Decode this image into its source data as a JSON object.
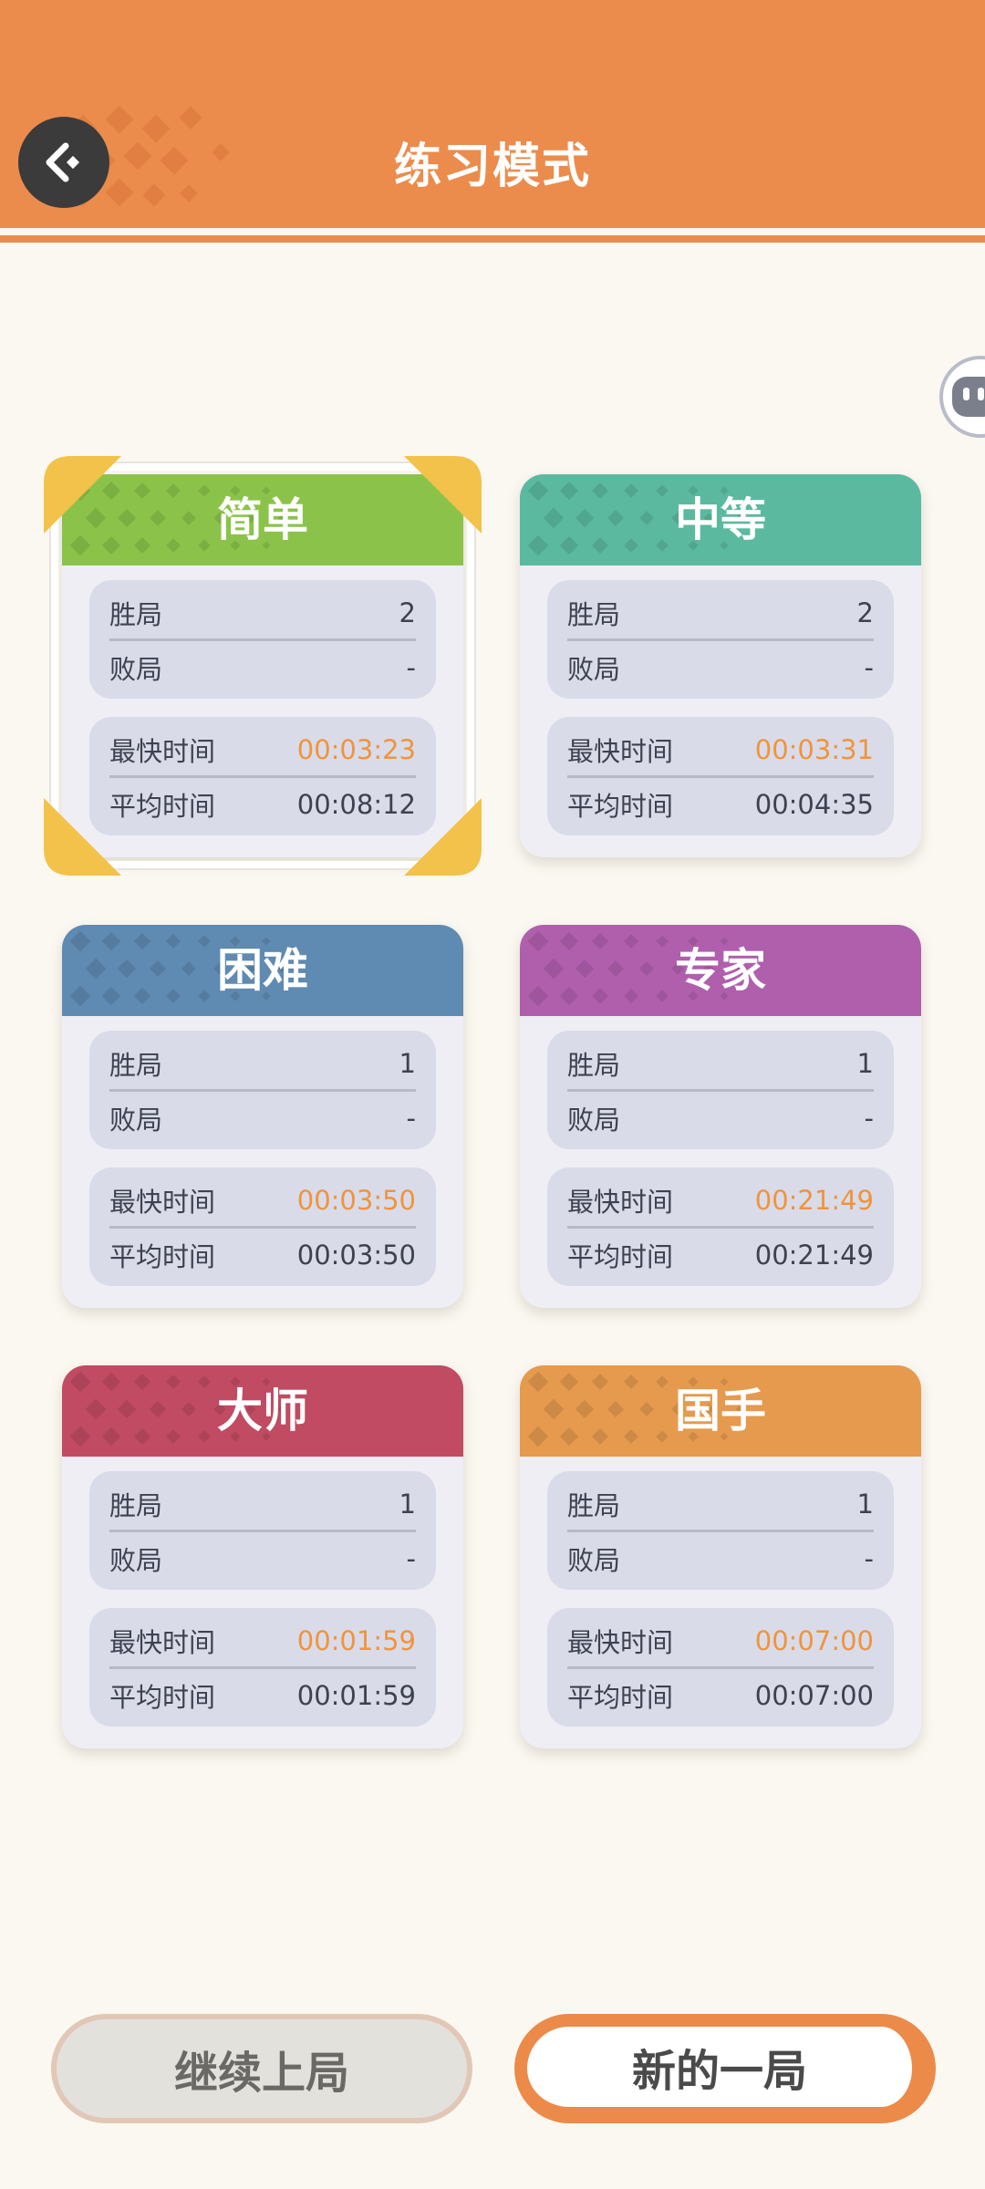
{
  "header": {
    "title": "练习模式",
    "color": "#eb8c4d"
  },
  "cards": [
    {
      "id": "easy",
      "title": "简单",
      "color": "#8bc34a",
      "selected": true,
      "wins_label": "胜局",
      "wins": "2",
      "losses_label": "败局",
      "losses": "-",
      "fastest_label": "最快时间",
      "fastest": "00:03:23",
      "average_label": "平均时间",
      "average": "00:08:12"
    },
    {
      "id": "medium",
      "title": "中等",
      "color": "#5bb9a0",
      "selected": false,
      "wins_label": "胜局",
      "wins": "2",
      "losses_label": "败局",
      "losses": "-",
      "fastest_label": "最快时间",
      "fastest": "00:03:31",
      "average_label": "平均时间",
      "average": "00:04:35"
    },
    {
      "id": "hard",
      "title": "困难",
      "color": "#5f8ab2",
      "selected": false,
      "wins_label": "胜局",
      "wins": "1",
      "losses_label": "败局",
      "losses": "-",
      "fastest_label": "最快时间",
      "fastest": "00:03:50",
      "average_label": "平均时间",
      "average": "00:03:50"
    },
    {
      "id": "expert",
      "title": "专家",
      "color": "#b05fad",
      "selected": false,
      "wins_label": "胜局",
      "wins": "1",
      "losses_label": "败局",
      "losses": "-",
      "fastest_label": "最快时间",
      "fastest": "00:21:49",
      "average_label": "平均时间",
      "average": "00:21:49"
    },
    {
      "id": "master",
      "title": "大师",
      "color": "#c04b62",
      "selected": false,
      "wins_label": "胜局",
      "wins": "1",
      "losses_label": "败局",
      "losses": "-",
      "fastest_label": "最快时间",
      "fastest": "00:01:59",
      "average_label": "平均时间",
      "average": "00:01:59"
    },
    {
      "id": "grandmaster",
      "title": "国手",
      "color": "#e59a4e",
      "selected": false,
      "wins_label": "胜局",
      "wins": "1",
      "losses_label": "败局",
      "losses": "-",
      "fastest_label": "最快时间",
      "fastest": "00:07:00",
      "average_label": "平均时间",
      "average": "00:07:00"
    }
  ],
  "accent_color": "#f0943c",
  "buttons": {
    "continue_label": "继续上局",
    "new_label": "新的一局"
  },
  "icons": {
    "back": "back-arrow-icon",
    "side_widget": "assistant-face-icon"
  }
}
